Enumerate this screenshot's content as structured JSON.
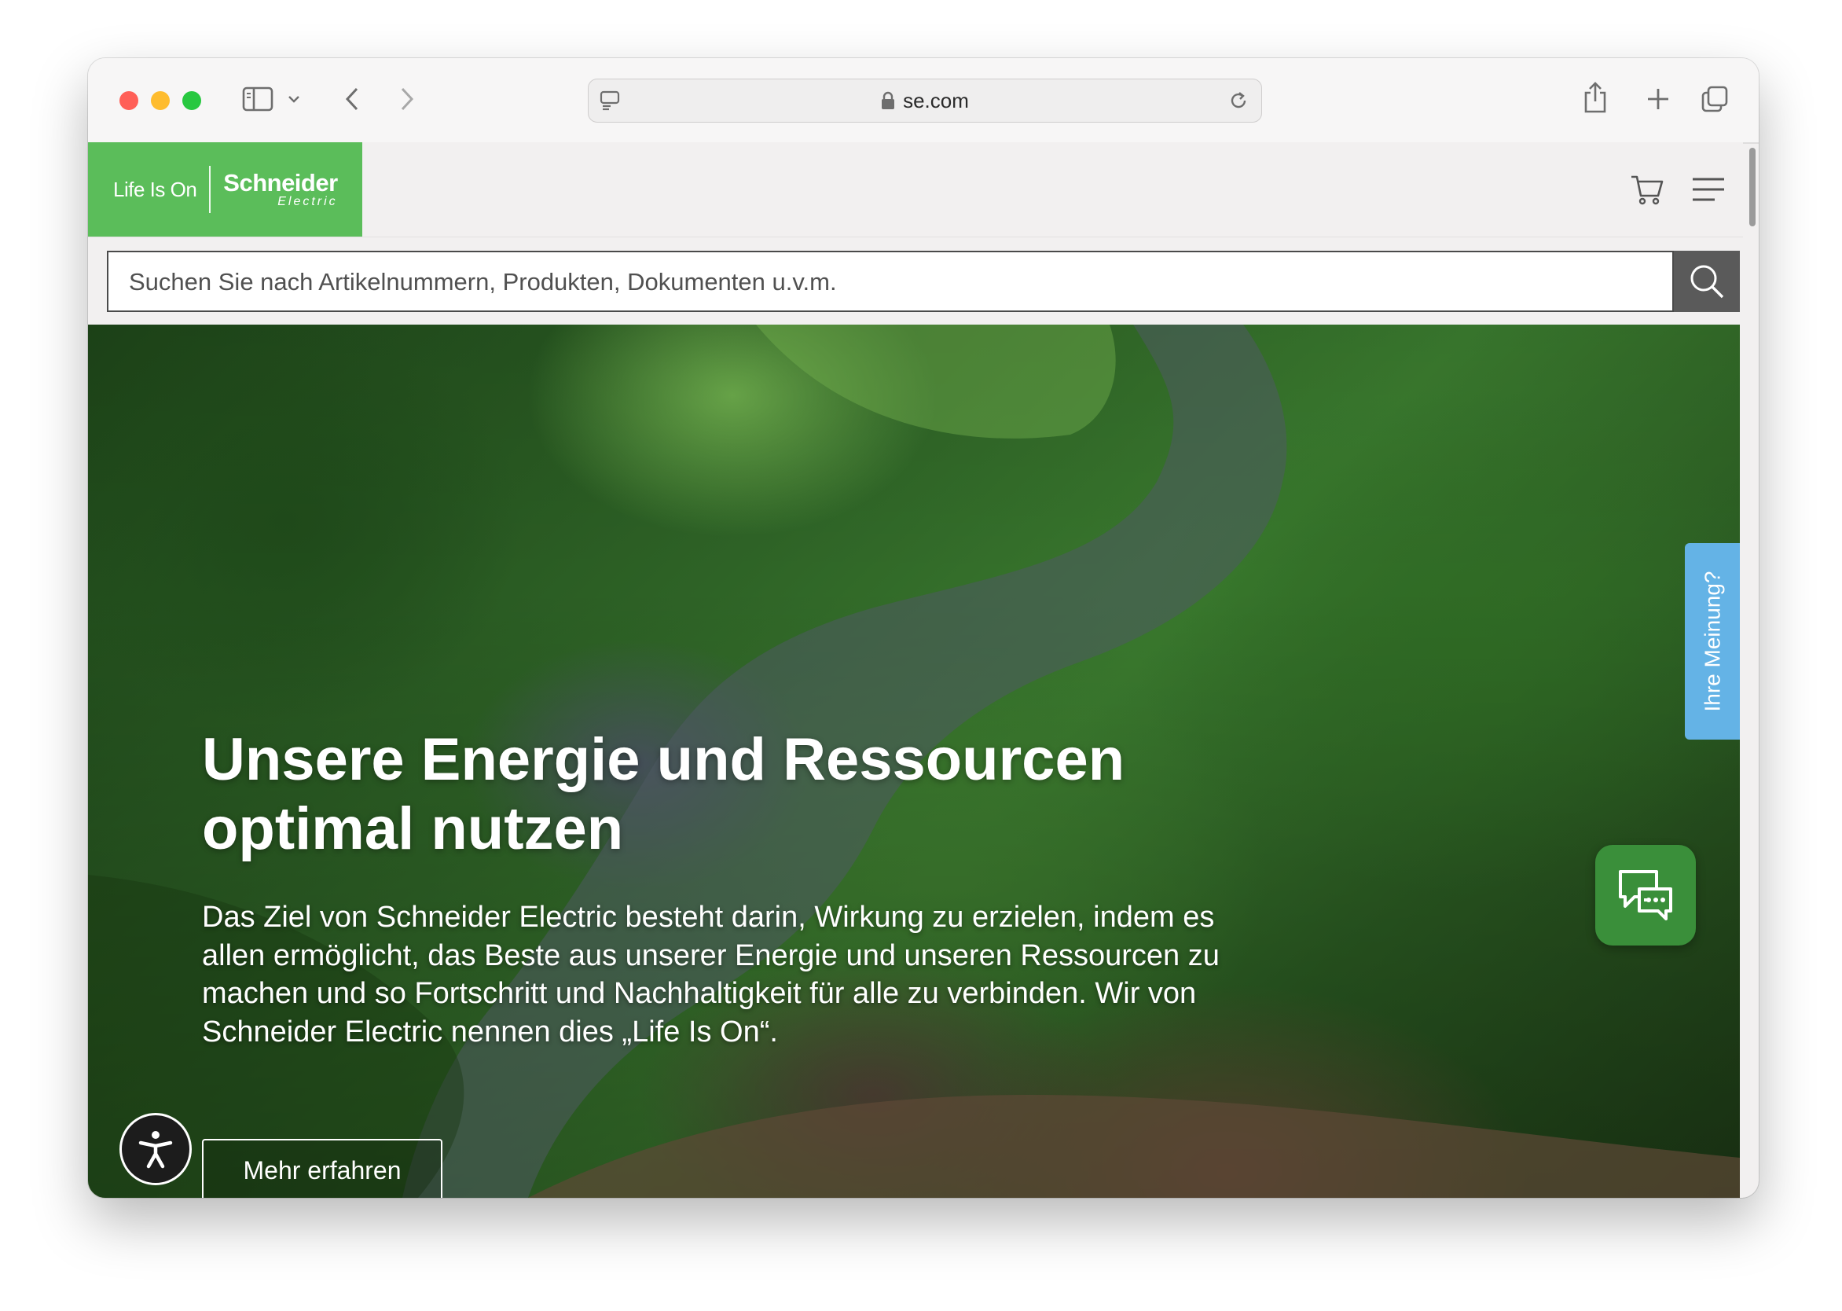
{
  "browser": {
    "url": "se.com"
  },
  "header": {
    "logo_tagline": "Life Is On",
    "logo_brand": "Schneider",
    "logo_sub": "Electric"
  },
  "search": {
    "placeholder": "Suchen Sie nach Artikelnummern, Produkten, Dokumenten u.v.m."
  },
  "hero": {
    "title": "Unsere Energie und Ressourcen optimal nutzen",
    "text": "Das Ziel von Schneider Electric besteht darin, Wirkung zu erzielen, indem es allen ermöglicht, das Beste aus unserer Energie und unseren Ressourcen zu machen und so Fortschritt und Nachhaltigkeit für alle zu verbinden. Wir von Schneider Electric nennen dies „Life Is On“.",
    "button_label": "Mehr erfahren"
  },
  "feedback": {
    "label": "Ihre Meinung?"
  },
  "colors": {
    "brand_green": "#5bbd5a",
    "chat_green": "#3a8f3a",
    "feedback_blue": "#64b3e6"
  },
  "icons": {
    "cart": "cart-icon",
    "menu": "hamburger-menu-icon",
    "search": "magnifier-icon",
    "accessibility": "accessibility-person-icon",
    "chat": "chat-bubbles-icon"
  }
}
